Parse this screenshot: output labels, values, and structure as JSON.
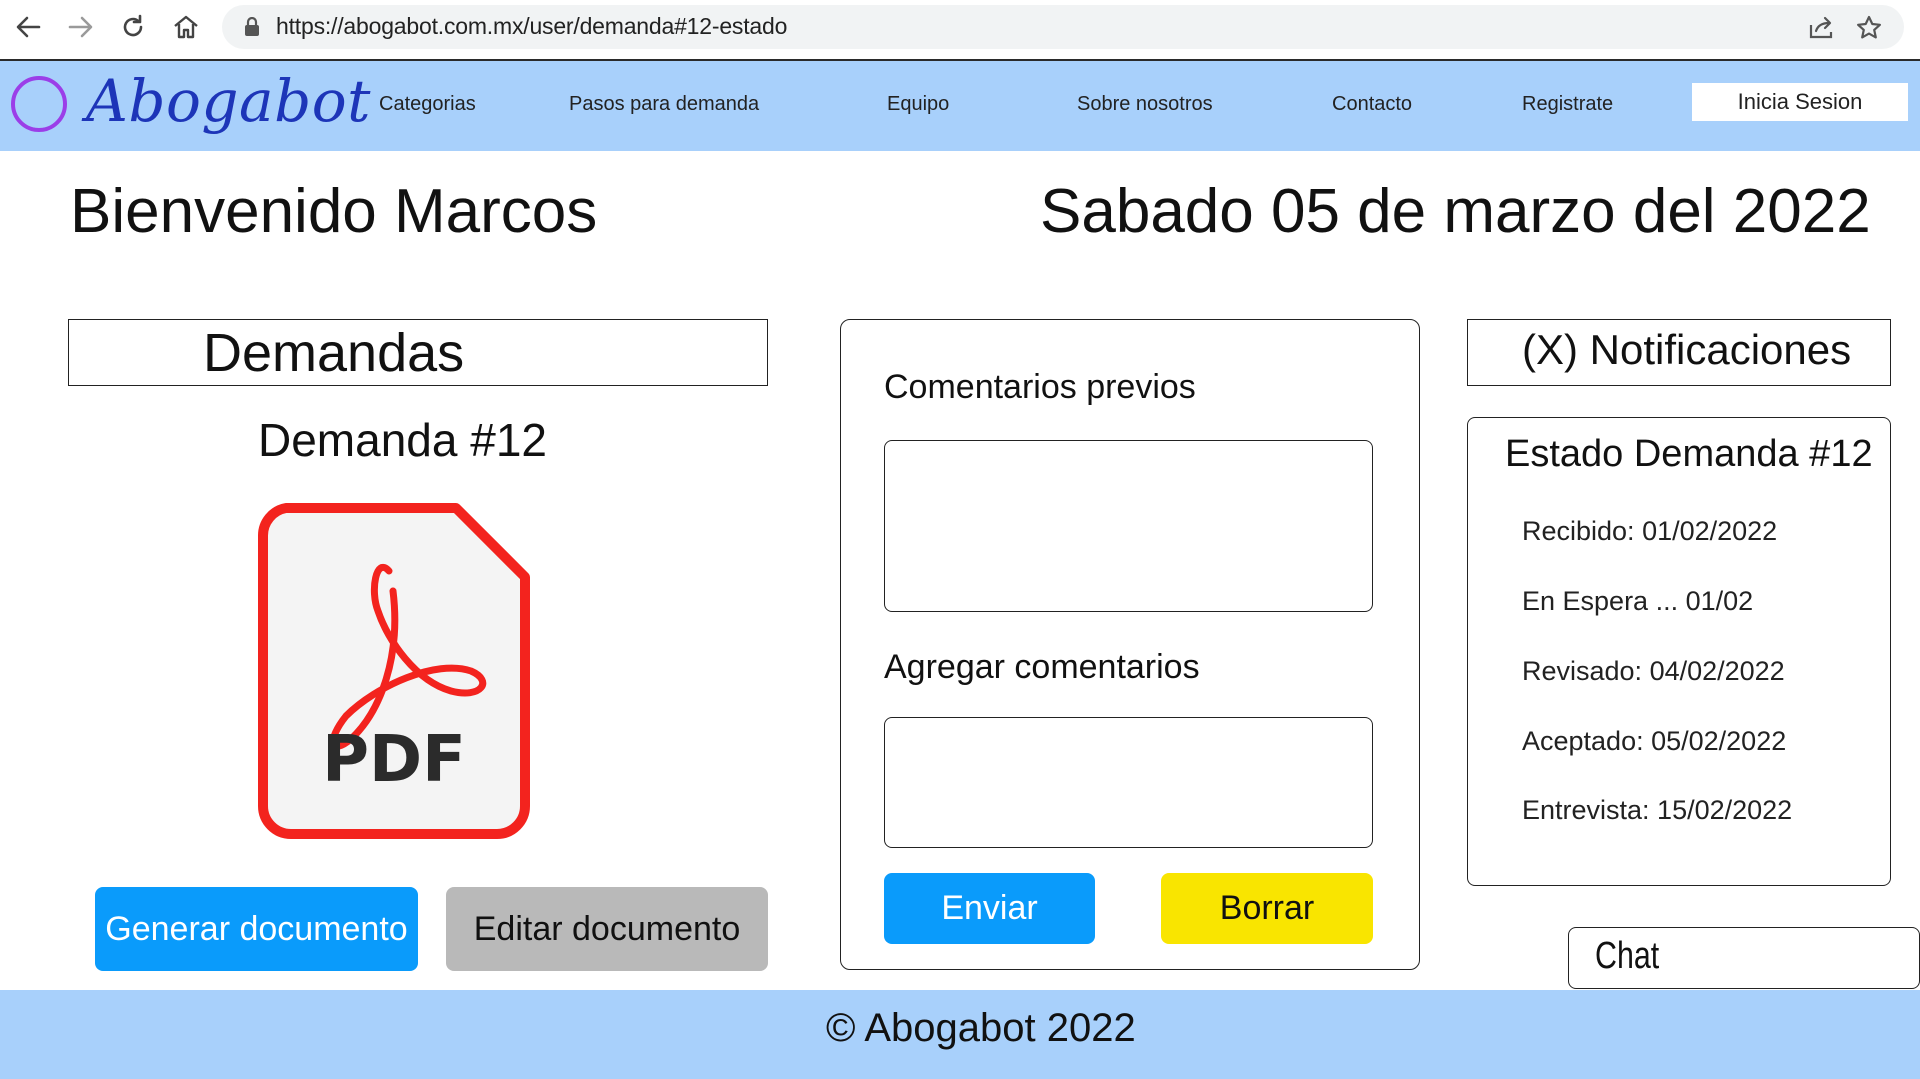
{
  "browser": {
    "url": "https://abogabot.com.mx/user/demanda#12-estado",
    "icons": [
      "back-arrow-icon",
      "forward-arrow-icon",
      "reload-icon",
      "home-icon",
      "lock-icon",
      "share-icon",
      "star-icon"
    ]
  },
  "header": {
    "logo_text": "Abogabot",
    "menu": [
      "Categorias",
      "Pasos para demanda",
      "Equipo",
      "Sobre nosotros",
      "Contacto",
      "Registrate"
    ],
    "login_label": "Inicia Sesion",
    "background_color": "#a8d0fb",
    "logo_color": "#1d35b8",
    "logo_circle_color": "#9b3ee8"
  },
  "headline": {
    "welcome": "Bienvenido Marcos",
    "date": "Sabado 05 de marzo del 2022"
  },
  "demandas": {
    "title": "Demandas",
    "current": "Demanda #12",
    "file_icon_label": "PDF",
    "generate_label": "Generar documento",
    "edit_label": "Editar documento"
  },
  "comments": {
    "previous_label": "Comentarios previos",
    "previous_value": "",
    "add_label": "Agregar comentarios",
    "add_value": "",
    "send_label": "Enviar",
    "clear_label": "Borrar",
    "send_color": "#0a9bfb",
    "clear_color": "#f9e500"
  },
  "notifications": {
    "title": "(X) Notificaciones"
  },
  "status": {
    "title": "Estado Demanda #12",
    "items": [
      "Recibido: 01/02/2022",
      "En Espera ... 01/02",
      "Revisado: 04/02/2022",
      "Aceptado: 05/02/2022",
      "Entrevista: 15/02/2022"
    ]
  },
  "chat": {
    "label": "Chat"
  },
  "footer": {
    "text": "©  Abogabot 2022"
  }
}
